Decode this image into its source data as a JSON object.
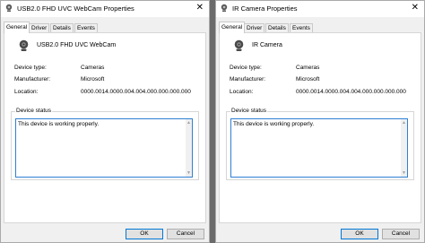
{
  "dialogs": [
    {
      "title": "USB2.0 FHD UVC WebCam Properties",
      "tabs": [
        "General",
        "Driver",
        "Details",
        "Events"
      ],
      "active_tab": "General",
      "device_name": "USB2.0 FHD UVC WebCam",
      "properties": [
        {
          "label": "Device type:",
          "value": "Cameras"
        },
        {
          "label": "Manufacturer:",
          "value": "Microsoft"
        },
        {
          "label": "Location:",
          "value": "0000.0014.0000.004.004.000.000.000.000"
        }
      ],
      "status_legend": "Device status",
      "status_text": "This device is working properly.",
      "ok_label": "OK",
      "cancel_label": "Cancel",
      "close_glyph": "✕"
    },
    {
      "title": "IR Camera Properties",
      "tabs": [
        "General",
        "Driver",
        "Details",
        "Events"
      ],
      "active_tab": "General",
      "device_name": "IR Camera",
      "properties": [
        {
          "label": "Device type:",
          "value": "Cameras"
        },
        {
          "label": "Manufacturer:",
          "value": "Microsoft"
        },
        {
          "label": "Location:",
          "value": "0000.0014.0000.004.004.000.000.000.000"
        }
      ],
      "status_legend": "Device status",
      "status_text": "This device is working properly.",
      "ok_label": "OK",
      "cancel_label": "Cancel",
      "close_glyph": "✕"
    }
  ],
  "icons": {
    "title_icon": "webcam-icon",
    "device_icon": "webcam-icon",
    "close_icon": "close-icon"
  },
  "colors": {
    "focus_border": "#2f7fd4",
    "default_button_border": "#0078d7"
  }
}
